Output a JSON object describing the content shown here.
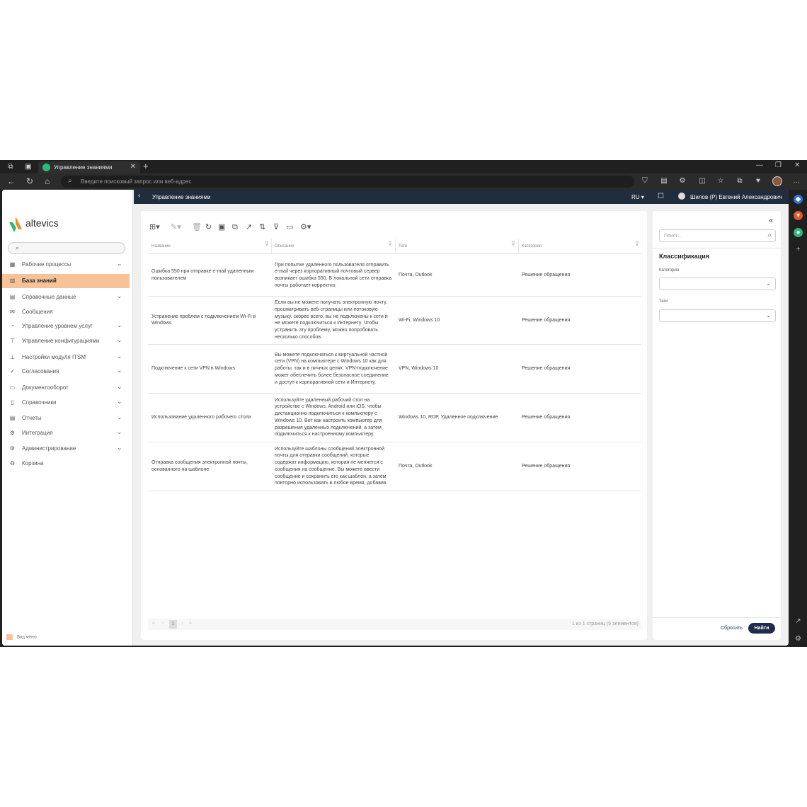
{
  "browser": {
    "tab_title": "Управление знаниями",
    "address_placeholder": "Введите поисковый запрос или веб-адрес"
  },
  "app": {
    "logo_text": "altevics",
    "page_title": "Управление знаниями",
    "language": "RU",
    "user_name": "Шилов (P) Евгений Александрович",
    "accent_color": "#f7c297",
    "header_color": "#1f2d3d"
  },
  "sidebar": {
    "items": [
      {
        "label": "Рабочие процессы",
        "icon": "grid-icon",
        "chevron": true
      },
      {
        "label": "База знаний",
        "icon": "bank-icon",
        "chevron": false,
        "active": true
      },
      {
        "label": "Справочные данные",
        "icon": "list-icon",
        "chevron": true
      },
      {
        "label": "Сообщения",
        "icon": "mail-icon",
        "chevron": false
      },
      {
        "label": "Управление уровнем услуг",
        "icon": "pie-chart-icon",
        "chevron": true
      },
      {
        "label": "Управление конфигурациями",
        "icon": "sitemap-icon",
        "chevron": true
      },
      {
        "label": "Настройки модуля ITSM",
        "icon": "org-icon",
        "chevron": true
      },
      {
        "label": "Согласования",
        "icon": "check-icon",
        "chevron": true
      },
      {
        "label": "Документооборот",
        "icon": "inbox-icon",
        "chevron": true
      },
      {
        "label": "Справочники",
        "icon": "book-icon",
        "chevron": true
      },
      {
        "label": "Отчеты",
        "icon": "report-icon",
        "chevron": true
      },
      {
        "label": "Интеграция",
        "icon": "gear-icon",
        "chevron": true
      },
      {
        "label": "Администрирование",
        "icon": "gear-icon",
        "chevron": true
      },
      {
        "label": "Корзина",
        "icon": "recycle-icon",
        "chevron": false
      }
    ],
    "footer": "Вид меню"
  },
  "grid": {
    "columns": [
      "Название",
      "Описание",
      "Теги",
      "Категория"
    ],
    "rows": [
      {
        "name": "Ошибка 550 при отправке e-mail удаленным пользователем",
        "description": "При попытке удаленного пользователя отправить e-mail через корпоративный почтовый сервер возникает ошибка 550. В локальной сети отправка почты работает корректно.",
        "tags": "Почта, Outlook",
        "category": "Решение обращения"
      },
      {
        "name": "Устранение проблем с подключением Wi-Fi в Windows",
        "description": "Если вы не можете получать электронную почту, просматривать веб-страницы или потоковую музыку, скорее всего, вы не подключены к сети и не можете подключиться к Интернету. Чтобы устранить эту проблему, можно попробовать несколько способов.",
        "tags": "Wi-Fi, Windows 10",
        "category": "Решение обращения"
      },
      {
        "name": "Подключение к сети VPN в Windows",
        "description": "Вы можете подключаться к виртуальной частной сети (VPN) на компьютере с Windows 10 как для работы, так и в личных целях. VPN-подключение может обеспечить более безопасное соединение и доступ к корпоративной сети и Интернету.",
        "tags": "VPN, Windows 10",
        "category": "Решение обращения"
      },
      {
        "name": "Использование удаленного рабочего стола",
        "description": "Используйте удаленный рабочий стол на устройстве с Windows, Android или iOS, чтобы дистанционно подключиться к компьютеру с Windows 10. Вот как настроить компьютер для разрешения удаленных подключений, а затем подключиться к настроенному компьютеру.",
        "tags": "Windows 10, RDP, Удаленное подключение",
        "category": "Решение обращения"
      },
      {
        "name": "Отправка сообщения электронной почты, основанного на шаблоне",
        "description": "Используйте шаблоны сообщений электронной почты для отправки сообщений, которые содержат информацию, которая не меняется с сообщения на сообщение. Вы можете ввести сообщение и сохранить его как шаблон, а затем повторно использовать в любое время, добавив",
        "tags": "Почта, Outlook",
        "category": "Решение обращения"
      }
    ],
    "pager": {
      "current_page": "1",
      "info": "1 из 1 страниц (5 элементов)"
    }
  },
  "filters": {
    "search_placeholder": "Поиск...",
    "title": "Классификация",
    "category_label": "Категория",
    "tags_label": "Теги",
    "reset_label": "Сбросить",
    "find_label": "Найти"
  }
}
